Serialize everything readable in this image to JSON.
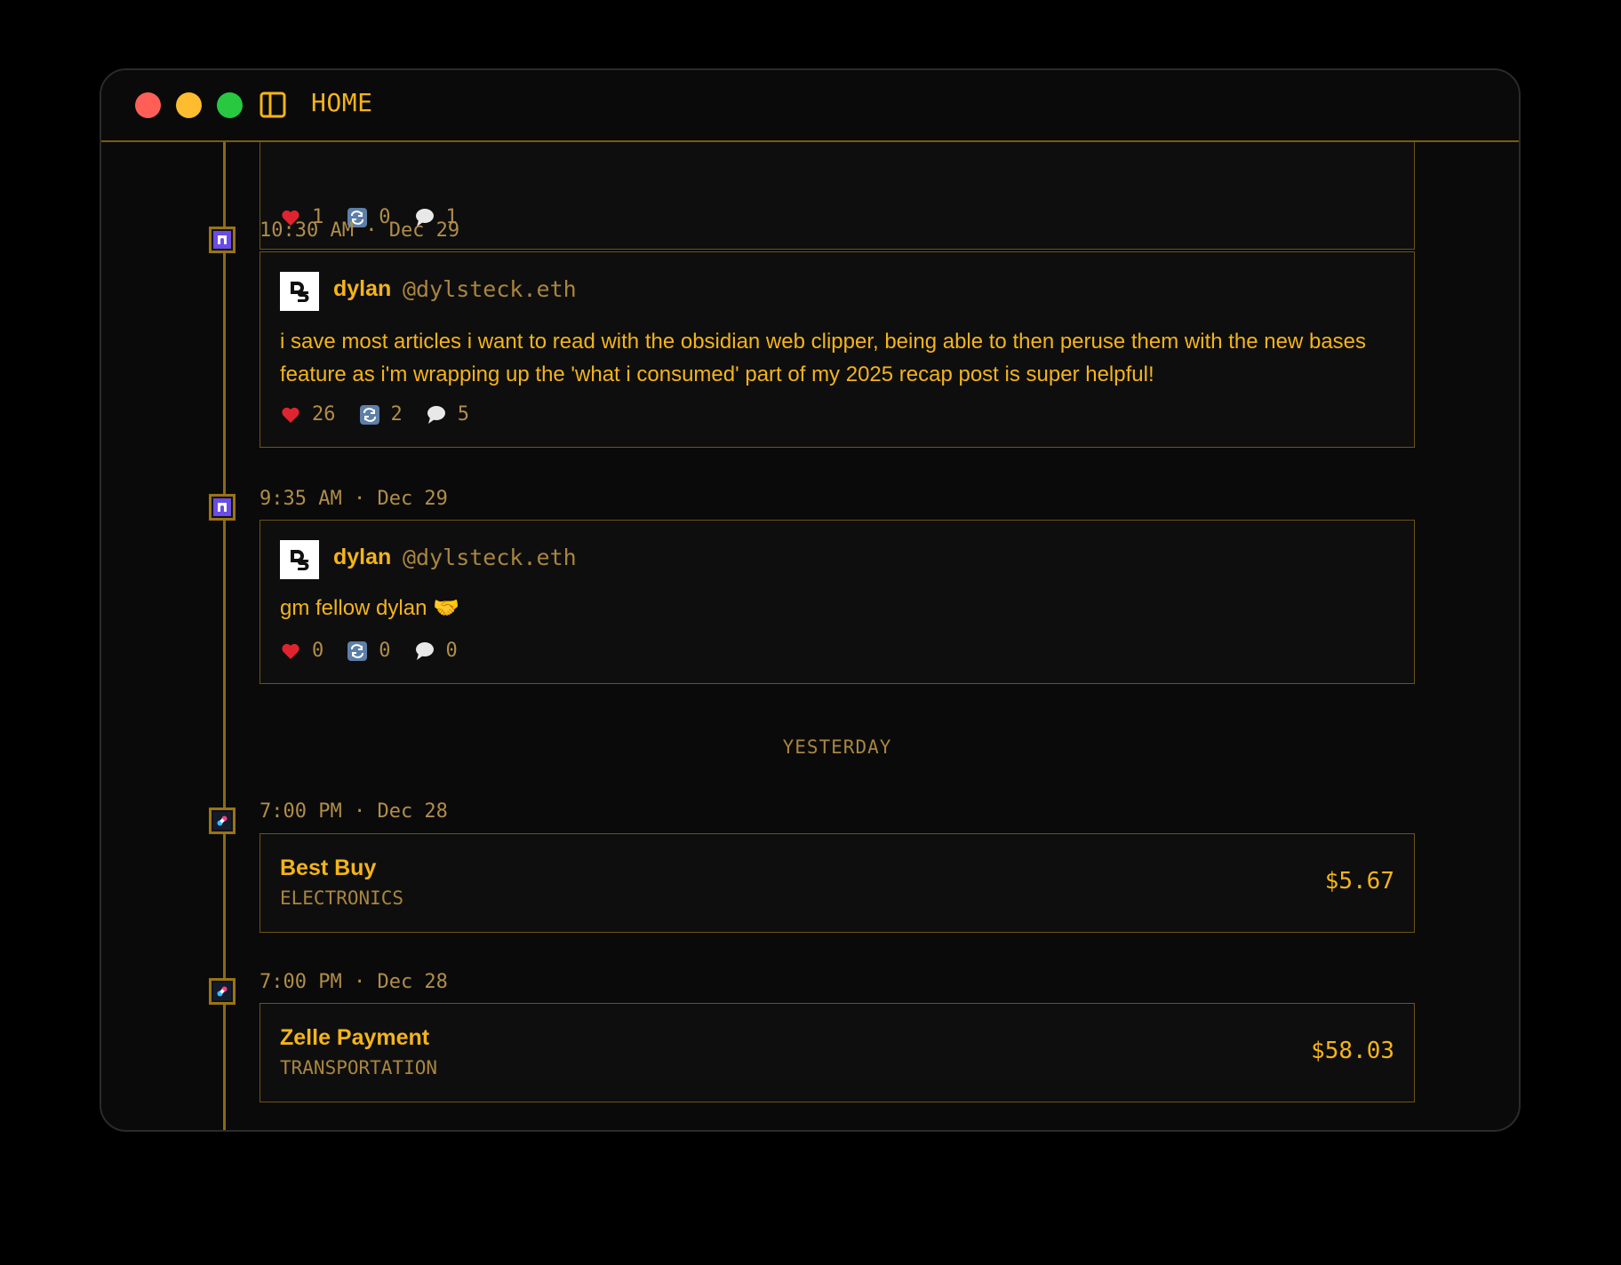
{
  "window": {
    "title": "HOME"
  },
  "timeline": {
    "top_card": {
      "likes": "1",
      "recasts": "0",
      "replies": "1"
    },
    "posts": [
      {
        "timestamp": "10:30 AM · Dec 29",
        "author_name": "dylan",
        "author_handle": "@dylsteck.eth",
        "text": "i save most articles i want to read with the obsidian web clipper, being able to then peruse them with the new bases feature as i'm wrapping up the 'what i consumed' part of my 2025 recap post is super helpful!",
        "likes": "26",
        "recasts": "2",
        "replies": "5"
      },
      {
        "timestamp": "9:35 AM · Dec 29",
        "author_name": "dylan",
        "author_handle": "@dylsteck.eth",
        "text": "gm fellow dylan 🤝",
        "likes": "0",
        "recasts": "0",
        "replies": "0"
      }
    ],
    "divider": "YESTERDAY",
    "transactions": [
      {
        "timestamp": "7:00 PM · Dec 28",
        "merchant": "Best Buy",
        "category": "ELECTRONICS",
        "amount": "$5.67"
      },
      {
        "timestamp": "7:00 PM · Dec 28",
        "merchant": "Zelle Payment",
        "category": "TRANSPORTATION",
        "amount": "$58.03"
      }
    ]
  },
  "colors": {
    "accent": "#f4b41a",
    "muted": "#b08d4a",
    "border": "#6e5413",
    "background": "#0a0a0a",
    "farcaster_purple": "#6a4ce6"
  },
  "icons": {
    "like": "heart-icon",
    "recast": "recast-icon",
    "reply": "speech-bubble-icon",
    "source_post": "farcaster-icon",
    "source_transaction": "bank-app-icon"
  }
}
